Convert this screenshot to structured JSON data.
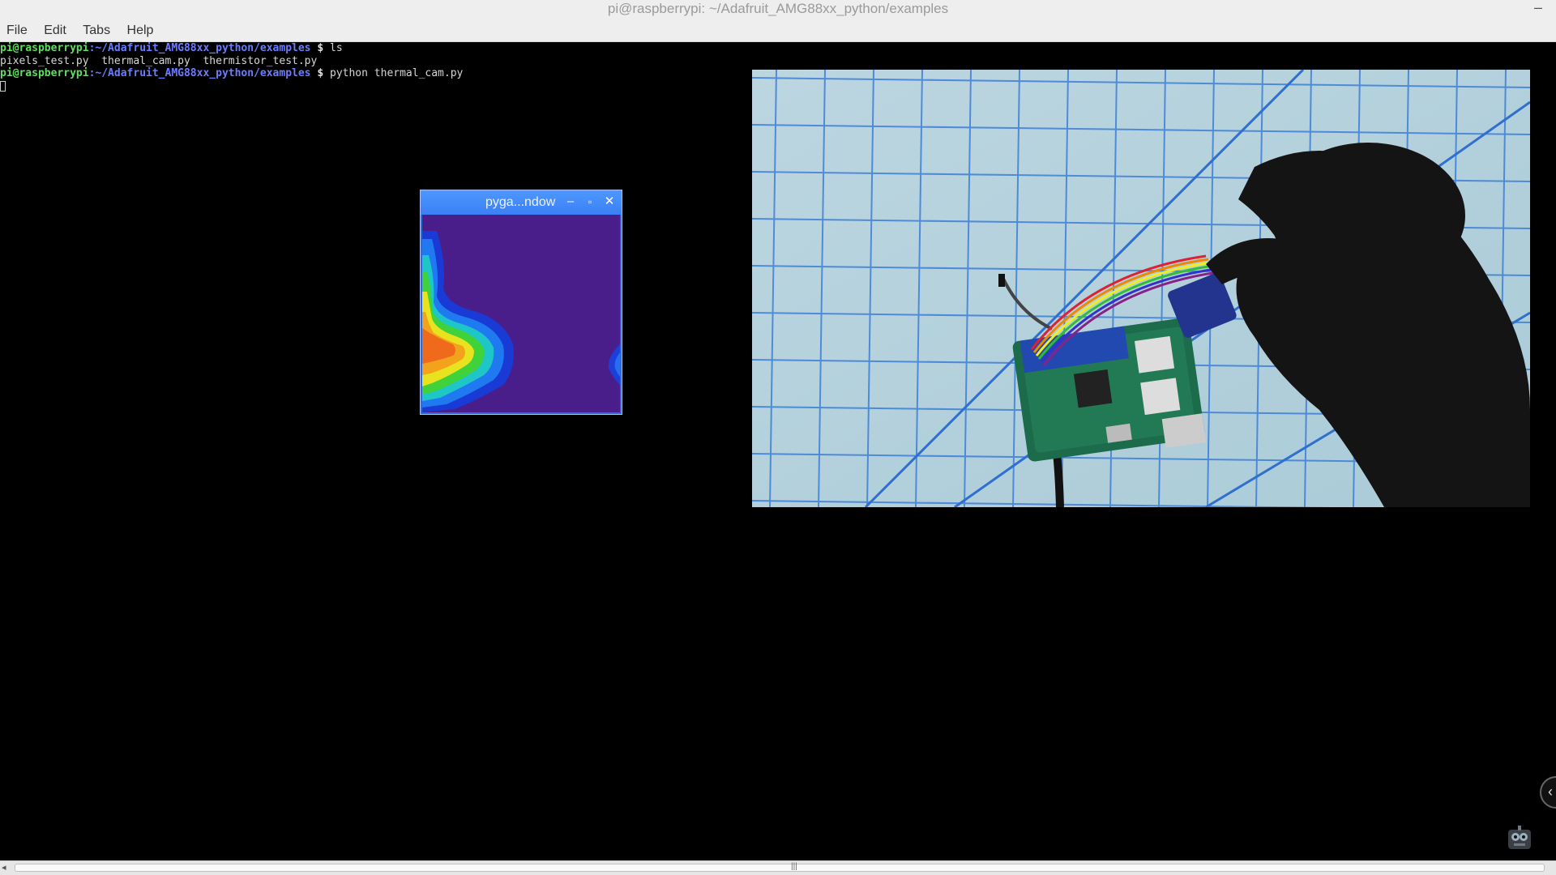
{
  "window": {
    "title": "pi@raspberrypi: ~/Adafruit_AMG88xx_python/examples",
    "minimize_glyph": "–"
  },
  "menu": {
    "items": [
      "File",
      "Edit",
      "Tabs",
      "Help"
    ]
  },
  "terminal": {
    "lines": [
      {
        "user": "pi@raspberrypi",
        "path": ":~/Adafruit_AMG88xx_python/examples",
        "dollar": " $",
        "cmd": " ls"
      },
      {
        "output": "pixels_test.py  thermal_cam.py  thermistor_test.py"
      },
      {
        "user": "pi@raspberrypi",
        "path": ":~/Adafruit_AMG88xx_python/examples",
        "dollar": " $",
        "cmd": " python thermal_cam.py"
      }
    ]
  },
  "pygame_window": {
    "title": "pyga...ndow",
    "minimize_glyph": "–",
    "maximize_glyph": "▫",
    "close_glyph": "✕"
  },
  "colors": {
    "pygame_title": "#3b7ff5",
    "thermal_background": "#4a1e8a",
    "prompt_user": "#5ee05e",
    "prompt_path": "#6a7dff"
  },
  "scrollbar": {
    "left_arrow": "◂",
    "grip": "|||"
  },
  "side_button": {
    "glyph": "‹"
  }
}
